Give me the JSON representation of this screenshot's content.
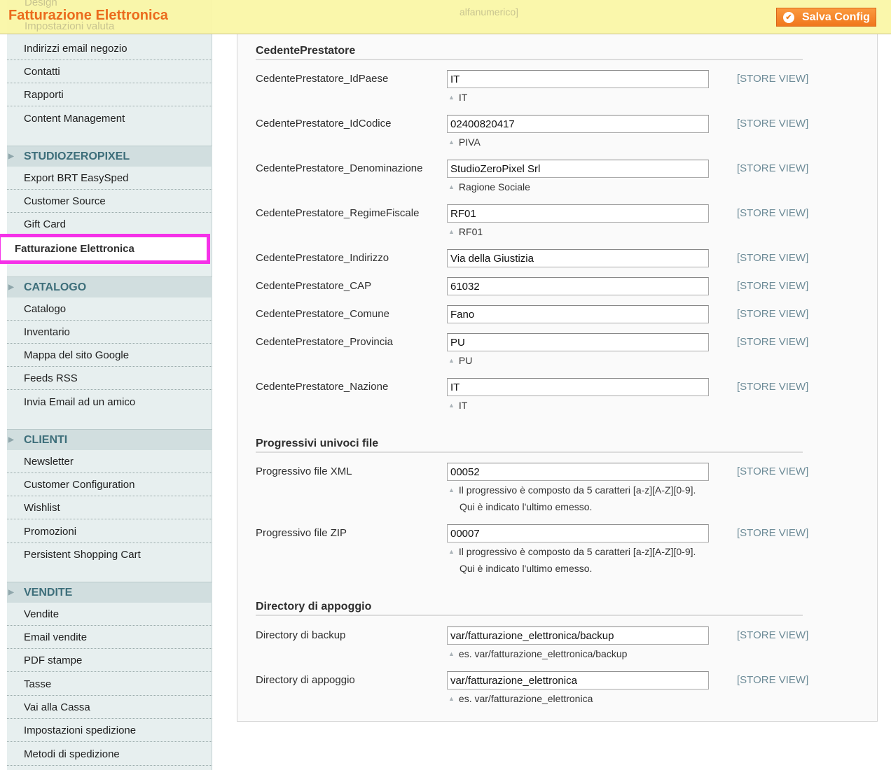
{
  "header": {
    "title": "Fatturazione Elettronica",
    "save_label": "Salva Config",
    "save_icon": "check-circle-icon",
    "faded_top": "Design",
    "faded_sub": "Impostazioni valuta",
    "faded_right": "alfanumerico]",
    "accent": "#eb6b1d"
  },
  "sidebar": {
    "top_items": [
      "Indirizzi email negozio",
      "Contatti",
      "Rapporti",
      "Content Management"
    ],
    "sections": [
      {
        "title": "STUDIOZEROPIXEL",
        "items": [
          "Export BRT EasySped",
          "Customer Source",
          "Gift Card",
          "Fatturazione Elettronica"
        ]
      },
      {
        "title": "CATALOGO",
        "items": [
          "Catalogo",
          "Inventario",
          "Mappa del sito Google",
          "Feeds RSS",
          "Invia Email ad un amico"
        ]
      },
      {
        "title": "CLIENTI",
        "items": [
          "Newsletter",
          "Customer Configuration",
          "Wishlist",
          "Promozioni",
          "Persistent Shopping Cart"
        ]
      },
      {
        "title": "VENDITE",
        "items": [
          "Vendite",
          "Email vendite",
          "PDF stampe",
          "Tasse",
          "Vai alla Cassa",
          "Impostazioni spedizione",
          "Metodi di spedizione"
        ]
      }
    ],
    "active": "Fatturazione Elettronica"
  },
  "main": {
    "scope": "[STORE VIEW]",
    "groups": [
      {
        "title": "CedentePrestatore",
        "fields": [
          {
            "label": "CedentePrestatore_IdPaese",
            "value": "IT",
            "note": "IT"
          },
          {
            "label": "CedentePrestatore_IdCodice",
            "value": "02400820417",
            "note": "PIVA"
          },
          {
            "label": "CedentePrestatore_Denominazione",
            "value": "StudioZeroPixel Srl",
            "note": "Ragione Sociale"
          },
          {
            "label": "CedentePrestatore_RegimeFiscale",
            "value": "RF01",
            "note": "RF01"
          },
          {
            "label": "CedentePrestatore_Indirizzo",
            "value": "Via della Giustizia"
          },
          {
            "label": "CedentePrestatore_CAP",
            "value": "61032"
          },
          {
            "label": "CedentePrestatore_Comune",
            "value": "Fano"
          },
          {
            "label": "CedentePrestatore_Provincia",
            "value": "PU",
            "note": "PU"
          },
          {
            "label": "CedentePrestatore_Nazione",
            "value": "IT",
            "note": "IT"
          }
        ]
      },
      {
        "title": "Progressivi univoci file",
        "fields": [
          {
            "label": "Progressivo file XML",
            "value": "00052",
            "note": "Il progressivo è composto da 5 caratteri [a-z][A-Z][0-9].",
            "note2": "Qui è indicato l'ultimo emesso."
          },
          {
            "label": "Progressivo file ZIP",
            "value": "00007",
            "note": "Il progressivo è composto da 5 caratteri [a-z][A-Z][0-9].",
            "note2": "Qui è indicato l'ultimo emesso."
          }
        ]
      },
      {
        "title": "Directory di appoggio",
        "fields": [
          {
            "label": "Directory di backup",
            "value": "var/fatturazione_elettronica/backup",
            "note": "es. var/fatturazione_elettronica/backup"
          },
          {
            "label": "Directory di appoggio",
            "value": "var/fatturazione_elettronica",
            "note": "es. var/fatturazione_elettronica"
          }
        ]
      }
    ]
  }
}
